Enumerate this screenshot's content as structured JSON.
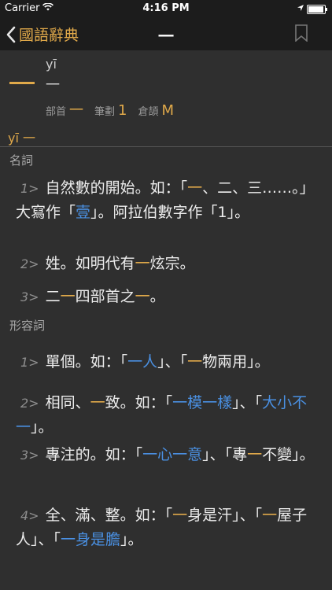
{
  "status": {
    "carrier": "Carrier",
    "time": "4:16 PM"
  },
  "nav": {
    "back_label": "國語辭典",
    "title": "一"
  },
  "entry": {
    "pinyin": "yī",
    "char": "一",
    "meta": [
      {
        "label": "部首",
        "value": "一"
      },
      {
        "label": "筆劃",
        "value": "1"
      },
      {
        "label": "倉頡",
        "value": "M"
      }
    ],
    "reading": "yī 一"
  },
  "sections": [
    {
      "pos": "名詞",
      "defs": [
        {
          "num": "1>",
          "parts": [
            [
              "t",
              "自然數的開始。如："
            ],
            [
              "t",
              "「"
            ],
            [
              "h",
              "一"
            ],
            [
              "t",
              "、二、三……。」大寫作「"
            ],
            [
              "l",
              "壹"
            ],
            [
              "t",
              "」。阿拉伯數字作「1」。"
            ]
          ]
        },
        {
          "num": "2>",
          "parts": [
            [
              "t",
              "姓。如明代有"
            ],
            [
              "h",
              "一"
            ],
            [
              "t",
              "炫宗。"
            ]
          ]
        },
        {
          "num": "3>",
          "parts": [
            [
              "t",
              "二"
            ],
            [
              "h",
              "一"
            ],
            [
              "t",
              "四部首之"
            ],
            [
              "h",
              "一"
            ],
            [
              "t",
              "。"
            ]
          ]
        }
      ]
    },
    {
      "pos": "形容詞",
      "defs": [
        {
          "num": "1>",
          "parts": [
            [
              "t",
              "單個。如：「"
            ],
            [
              "l",
              "一人"
            ],
            [
              "t",
              "」、「"
            ],
            [
              "h",
              "一"
            ],
            [
              "t",
              "物兩用」。"
            ]
          ]
        },
        {
          "num": "2>",
          "parts": [
            [
              "t",
              "相同、"
            ],
            [
              "h",
              "一"
            ],
            [
              "t",
              "致。如：「"
            ],
            [
              "l",
              "一模一樣"
            ],
            [
              "t",
              "」、「"
            ],
            [
              "l",
              "大小不一"
            ],
            [
              "t",
              "」。"
            ]
          ]
        },
        {
          "num": "3>",
          "parts": [
            [
              "t",
              "專注的。如：「"
            ],
            [
              "l",
              "一心一意"
            ],
            [
              "t",
              "」、「專"
            ],
            [
              "h",
              "一"
            ],
            [
              "t",
              "不變」。"
            ]
          ]
        },
        {
          "num": "4>",
          "parts": [
            [
              "t",
              "全、滿、整。如：「"
            ],
            [
              "h",
              "一"
            ],
            [
              "t",
              "身是汗」、「"
            ],
            [
              "h",
              "一"
            ],
            [
              "t",
              "屋子人」、「"
            ],
            [
              "l",
              "一身是膽"
            ],
            [
              "t",
              "」。"
            ]
          ]
        }
      ]
    }
  ]
}
